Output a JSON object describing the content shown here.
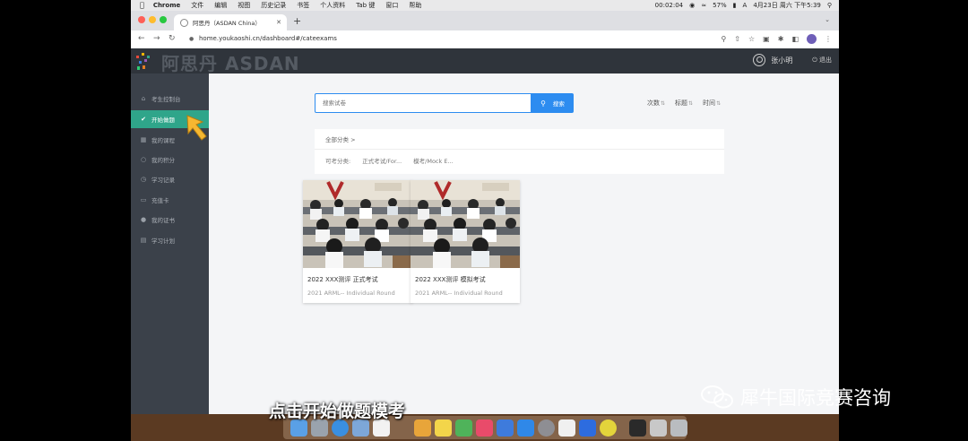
{
  "menubar": {
    "app": "Chrome",
    "menus": [
      "文件",
      "编辑",
      "视图",
      "历史记录",
      "书签",
      "个人资料",
      "Tab 键",
      "窗口",
      "帮助"
    ],
    "time": "00:02:04",
    "battery": "57%",
    "clock": "4月23日 周六 下午5:39"
  },
  "browser": {
    "tab_title": "阿思丹（ASDAN China）",
    "url": "home.youkaoshi.cn/dashboard#/cateexams"
  },
  "app": {
    "brand": "阿思丹 ASDAN",
    "user_name": "张小明",
    "logout": "退出"
  },
  "sidebar": {
    "items": [
      {
        "label": "考生控制台",
        "icon": "home-icon"
      },
      {
        "label": "开始做题",
        "icon": "check-circle-icon"
      },
      {
        "label": "我的课程",
        "icon": "book-icon"
      },
      {
        "label": "我的积分",
        "icon": "coin-icon"
      },
      {
        "label": "学习记录",
        "icon": "clock-icon"
      },
      {
        "label": "充值卡",
        "icon": "card-icon"
      },
      {
        "label": "我的证书",
        "icon": "certificate-icon"
      },
      {
        "label": "学习计划",
        "icon": "calendar-icon"
      }
    ]
  },
  "search": {
    "placeholder": "搜索试卷",
    "button": "搜索"
  },
  "sort": {
    "options": [
      "次数",
      "标题",
      "时间"
    ]
  },
  "filter": {
    "all": "全部分类 >",
    "label": "可考分类:",
    "options": [
      "正式考试/For...",
      "模考/Mock E..."
    ]
  },
  "exams": [
    {
      "title": "2022 XXX测评 正式考试",
      "subtitle": "2021 ARML-- Individual Round"
    },
    {
      "title": "2022 XXX测评 模拟考试",
      "subtitle": "2021 ARML-- Individual Round"
    }
  ],
  "caption": "点击开始做题模考",
  "watermark": "犀牛国际竞赛咨询"
}
